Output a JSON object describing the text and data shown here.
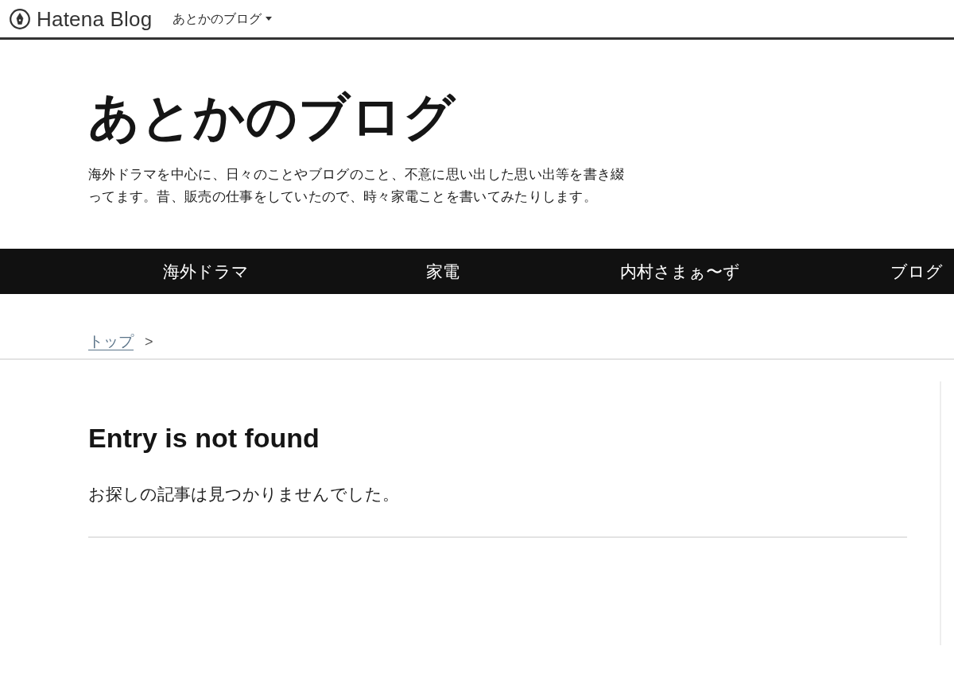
{
  "header": {
    "logo": "Hatena Blog",
    "blog_menu": "あとかのブログ"
  },
  "blog": {
    "title": "あとかのブログ",
    "description": "海外ドラマを中心に、日々のことやブログのこと、不意に思い出した思い出等を書き綴ってます。昔、販売の仕事をしていたので、時々家電ことを書いてみたりします。"
  },
  "nav": [
    {
      "label": "海外ドラマ"
    },
    {
      "label": "家電"
    },
    {
      "label": "内村さまぁ〜ず"
    },
    {
      "label": "ブログ"
    }
  ],
  "breadcrumb": {
    "link": "トップ",
    "separator": ">"
  },
  "entry": {
    "heading": "Entry is not found",
    "message": "お探しの記事は見つかりませんでした。"
  }
}
